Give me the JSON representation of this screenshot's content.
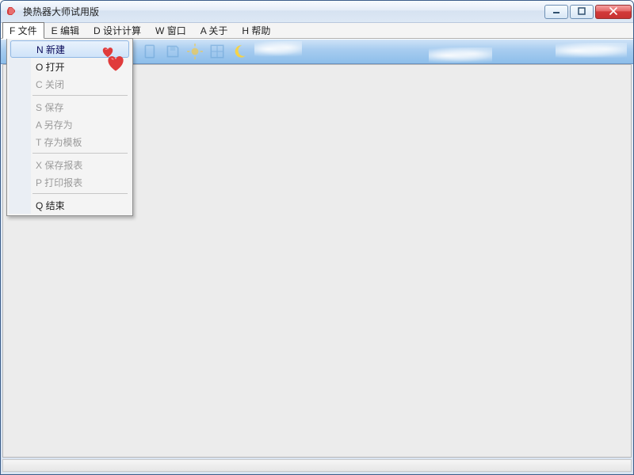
{
  "window": {
    "title": "换热器大师试用版"
  },
  "menubar": {
    "items": [
      {
        "label": "F 文件",
        "active": true
      },
      {
        "label": "E 编辑"
      },
      {
        "label": "D 设计计算"
      },
      {
        "label": "W 窗口"
      },
      {
        "label": "A 关于"
      },
      {
        "label": "H 帮助"
      }
    ]
  },
  "fileMenu": {
    "groups": [
      [
        {
          "label": "N 新建",
          "enabled": true,
          "highlight": true
        },
        {
          "label": "O 打开",
          "enabled": true
        },
        {
          "label": "C 关闭",
          "enabled": false
        }
      ],
      [
        {
          "label": "S 保存",
          "enabled": false
        },
        {
          "label": "A 另存为",
          "enabled": false
        },
        {
          "label": "T 存为模板",
          "enabled": false
        }
      ],
      [
        {
          "label": "X 保存报表",
          "enabled": false
        },
        {
          "label": "P 打印报表",
          "enabled": false
        }
      ],
      [
        {
          "label": "Q 结束",
          "enabled": true
        }
      ]
    ]
  },
  "toolbar": {
    "icons": [
      "file-icon",
      "save-icon",
      "sun-icon",
      "grid-icon",
      "moon-icon"
    ]
  }
}
